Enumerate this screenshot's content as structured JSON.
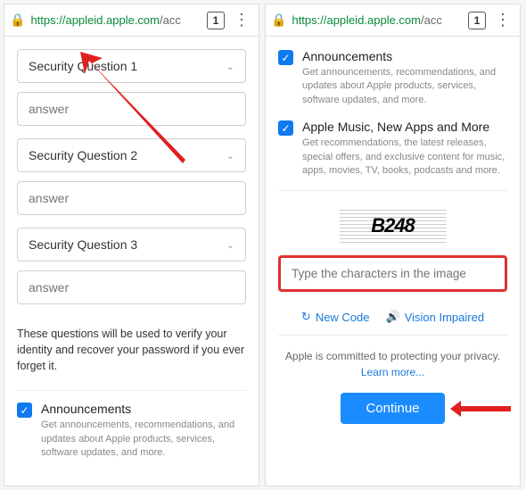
{
  "browser": {
    "url_secure": "https://",
    "url_host": "appleid.apple.com",
    "url_path": "/acc",
    "tab_count": "1"
  },
  "left": {
    "q1": "Security Question 1",
    "q2": "Security Question 2",
    "q3": "Security Question 3",
    "answer_ph": "answer",
    "note": "These questions will be used to verify your identity and recover your password if you ever forget it.",
    "announcements": {
      "title": "Announcements",
      "desc": "Get announcements, recommendations, and updates about Apple products, services, software updates, and more."
    }
  },
  "right": {
    "announcements": {
      "title": "Announcements",
      "desc": "Get announcements, recommendations, and updates about Apple products, services, software updates, and more."
    },
    "music": {
      "title": "Apple Music, New Apps and More",
      "desc": "Get recommendations, the latest releases, special offers, and exclusive content for music, apps, movies, TV, books, podcasts and more."
    },
    "captcha_text": "B248",
    "captcha_ph": "Type the characters in the image",
    "new_code": "New Code",
    "vision": "Vision Impaired",
    "privacy": "Apple is committed to protecting your privacy.",
    "learn": "Learn more...",
    "continue": "Continue"
  }
}
